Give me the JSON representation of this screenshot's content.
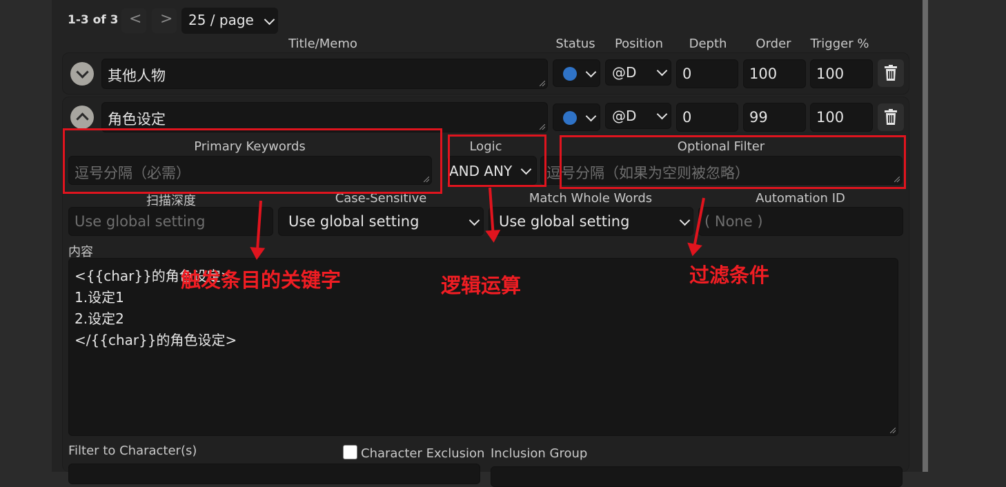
{
  "pagination": {
    "range": "1-3 of 3",
    "prev": "<",
    "next": ">",
    "page_size": "25 / page"
  },
  "headers": {
    "title": "Title/Memo",
    "status": "Status",
    "position": "Position",
    "depth": "Depth",
    "order": "Order",
    "trigger": "Trigger %"
  },
  "entries": [
    {
      "title": "其他人物",
      "position": "@D",
      "depth": "0",
      "order": "100",
      "trigger": "100",
      "status_color": "#2f73c7"
    },
    {
      "title": "角色设定",
      "position": "@D",
      "depth": "0",
      "order": "99",
      "trigger": "100",
      "status_color": "#2f73c7"
    }
  ],
  "expanded": {
    "primary_keywords": {
      "label": "Primary Keywords",
      "placeholder": "逗号分隔（必需）"
    },
    "logic": {
      "label": "Logic",
      "value": "AND ANY"
    },
    "optional_filter": {
      "label": "Optional Filter",
      "placeholder": "逗号分隔（如果为空则被忽略）"
    },
    "scan_depth": {
      "label": "扫描深度",
      "placeholder": "Use global setting"
    },
    "case_sensitive": {
      "label": "Case-Sensitive",
      "value": "Use global setting"
    },
    "match_whole_words": {
      "label": "Match Whole Words",
      "value": "Use global setting"
    },
    "automation_id": {
      "label": "Automation ID",
      "placeholder": "( None )"
    },
    "content": {
      "label": "内容",
      "lines": [
        "<{{char}}的角色设定>",
        "1.设定1",
        "2.设定2",
        "</{{char}}的角色设定>"
      ]
    },
    "filter_chars": {
      "label": "Filter to Character(s)"
    },
    "char_exclusion": {
      "label": "Character Exclusion",
      "checked": false
    },
    "inclusion_group": {
      "label": "Inclusion Group"
    }
  },
  "annotations": {
    "keywords": "触发条目的关键字",
    "logic": "逻辑运算",
    "filter": "过滤条件",
    "color": "#e0141e"
  }
}
